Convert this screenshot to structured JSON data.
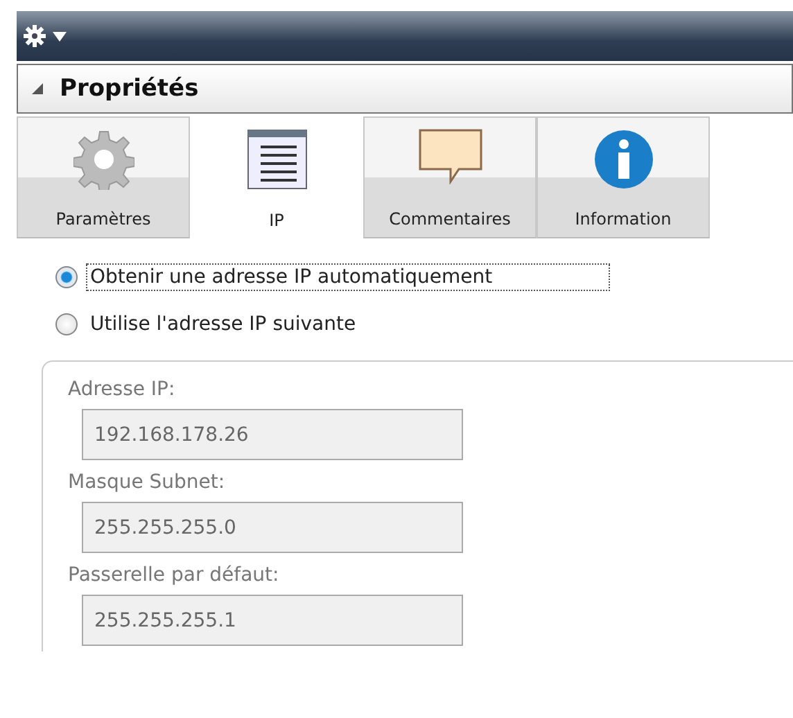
{
  "panel": {
    "title": "Propriétés",
    "expanded": true
  },
  "tabs": [
    {
      "label": "Paramètres",
      "kind": "gear",
      "selected": false
    },
    {
      "label": "IP",
      "kind": "list",
      "selected": true
    },
    {
      "label": "Commentaires",
      "kind": "comment",
      "selected": false
    },
    {
      "label": "Information",
      "kind": "info",
      "selected": false
    }
  ],
  "options": [
    {
      "label": "Obtenir une adresse IP automatiquement",
      "selected": true
    },
    {
      "label": "Utilise l'adresse IP suivante",
      "selected": false
    }
  ],
  "fields": [
    {
      "label": "Adresse IP:",
      "value": "192.168.178.26",
      "disabled": true
    },
    {
      "label": "Masque Subnet:",
      "value": "255.255.255.0",
      "disabled": true
    },
    {
      "label": "Passerelle par défaut:",
      "value": "255.255.255.1",
      "disabled": true
    }
  ]
}
